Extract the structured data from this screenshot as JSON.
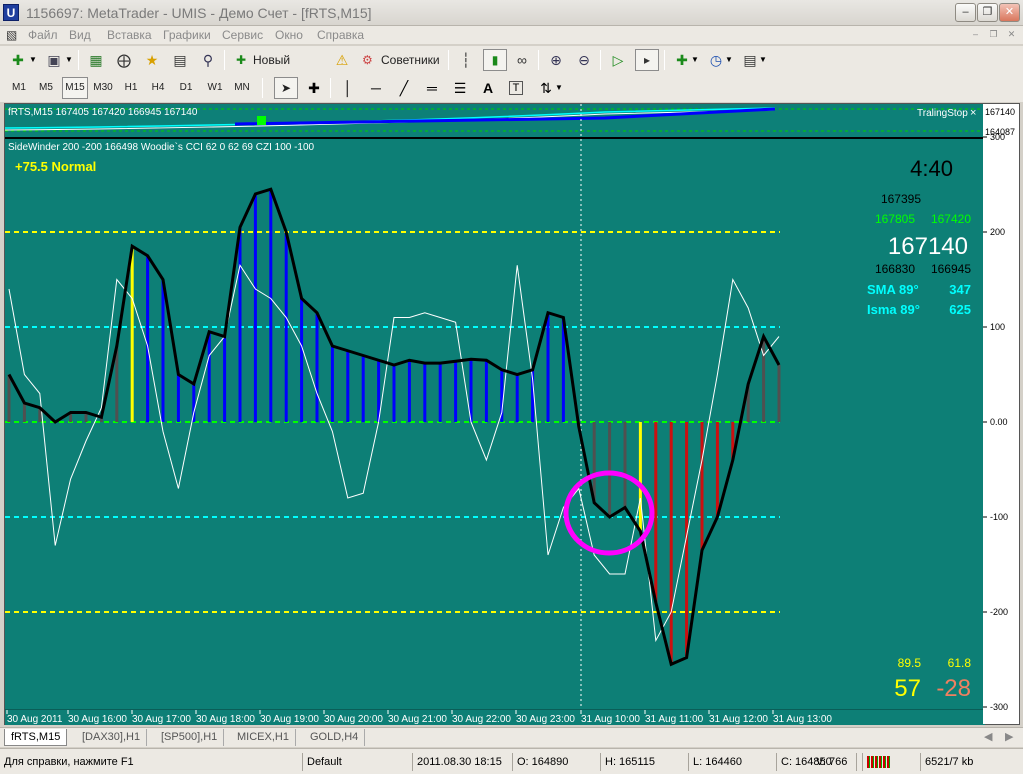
{
  "window": {
    "title": "1156697: MetaTrader - UMIS - Демо Счет - [fRTS,M15]",
    "icon_letter": "U"
  },
  "menu": {
    "items": [
      "Файл",
      "Вид",
      "Вставка",
      "Графики",
      "Сервис",
      "Окно",
      "Справка"
    ]
  },
  "toolbar": {
    "new_order": "Новый Ордер",
    "experts": "Советники"
  },
  "timeframes": [
    "M1",
    "M5",
    "M15",
    "M30",
    "H1",
    "H4",
    "D1",
    "W1",
    "MN"
  ],
  "timeframe_selected": "M15",
  "draw_tools": {
    "text_tool": "A",
    "label_tool": "T"
  },
  "chart": {
    "price_header": "fRTS,M15  167405 167420 166945 167140",
    "trailing_stop": "TralingStop",
    "close_x": "×",
    "price_high": "167140",
    "price_low": "164087",
    "indicator_header": "SideWinder 200 -200 166498  Woodie`s CCI 62 0 62 69  CZI 100 -100",
    "trend_label": "+75.5 Normal",
    "timer": "4:40",
    "info_open": "167395",
    "info_green_1": "167805",
    "info_green_2": "167420",
    "info_big_price": "167140",
    "info_low_1": "166830",
    "info_low_2": "166945",
    "sma_label": "SMA  89°",
    "sma_value": "347",
    "isma_label": "Isma 89°",
    "isma_value": "625",
    "bottom_val_1": "89.5",
    "bottom_val_2": "61.8",
    "bottom_big_1": "57",
    "bottom_big_2": "-28",
    "scale_ticks": [
      "300",
      "200",
      "100",
      "0.00",
      "-100",
      "-200",
      "-300"
    ],
    "time_labels": [
      "30 Aug 2011",
      "30 Aug 16:00",
      "30 Aug 17:00",
      "30 Aug 18:00",
      "30 Aug 19:00",
      "30 Aug 20:00",
      "30 Aug 21:00",
      "30 Aug 22:00",
      "30 Aug 23:00",
      "31 Aug 10:00",
      "31 Aug 11:00",
      "31 Aug 12:00",
      "31 Aug 13:00"
    ],
    "colors": {
      "background": "#0d7f76",
      "histogram_blue": "#0000ff",
      "histogram_red": "#cc1010",
      "histogram_gray": "#505050",
      "histogram_yellow": "#ffff00",
      "ellipse": "#ff00ff"
    },
    "cci_values": [
      50,
      20,
      15,
      0,
      10,
      10,
      5,
      80,
      185,
      175,
      150,
      50,
      40,
      95,
      90,
      205,
      240,
      245,
      200,
      130,
      115,
      80,
      75,
      70,
      65,
      60,
      65,
      62,
      62,
      64,
      66,
      65,
      55,
      50,
      55,
      115,
      110,
      -5,
      -85,
      -100,
      -90,
      -115,
      -190,
      -255,
      -248,
      -135,
      -100,
      -40,
      40,
      90,
      60
    ],
    "hist_colors": [
      "gray",
      "gray",
      "gray",
      "gray",
      "gray",
      "gray",
      "gray",
      "gray",
      "yellow",
      "blue",
      "blue",
      "blue",
      "blue",
      "blue",
      "blue",
      "blue",
      "blue",
      "blue",
      "blue",
      "blue",
      "blue",
      "blue",
      "blue",
      "blue",
      "blue",
      "blue",
      "blue",
      "blue",
      "blue",
      "blue",
      "blue",
      "blue",
      "blue",
      "blue",
      "blue",
      "blue",
      "blue",
      "gray",
      "gray",
      "gray",
      "gray",
      "yellow",
      "red",
      "red",
      "red",
      "red",
      "red",
      "red",
      "gray",
      "gray",
      "gray"
    ],
    "turbo_values": [
      140,
      50,
      30,
      -130,
      -60,
      -20,
      15,
      150,
      130,
      80,
      -10,
      -70,
      10,
      70,
      90,
      165,
      140,
      130,
      110,
      80,
      30,
      -10,
      -80,
      -75,
      0,
      110,
      110,
      115,
      110,
      105,
      0,
      -40,
      10,
      165,
      45,
      -140,
      -90,
      -70,
      -140,
      -160,
      -160,
      -80,
      -230,
      -200,
      -120,
      -40,
      50,
      150,
      120,
      70,
      90
    ]
  },
  "tabs": [
    "fRTS,M15",
    "[DAX30],H1",
    "[SP500],H1",
    "MICEX,H1",
    "GOLD,H4"
  ],
  "tab_active": "fRTS,M15",
  "status": {
    "help": "Для справки, нажмите F1",
    "profile": "Default",
    "datetime": "2011.08.30 18:15",
    "open": "O: 164890",
    "high": "H: 165115",
    "low": "L: 164460",
    "close": "C: 164850",
    "volume": "V: 766",
    "traffic": "6521/7 kb"
  }
}
